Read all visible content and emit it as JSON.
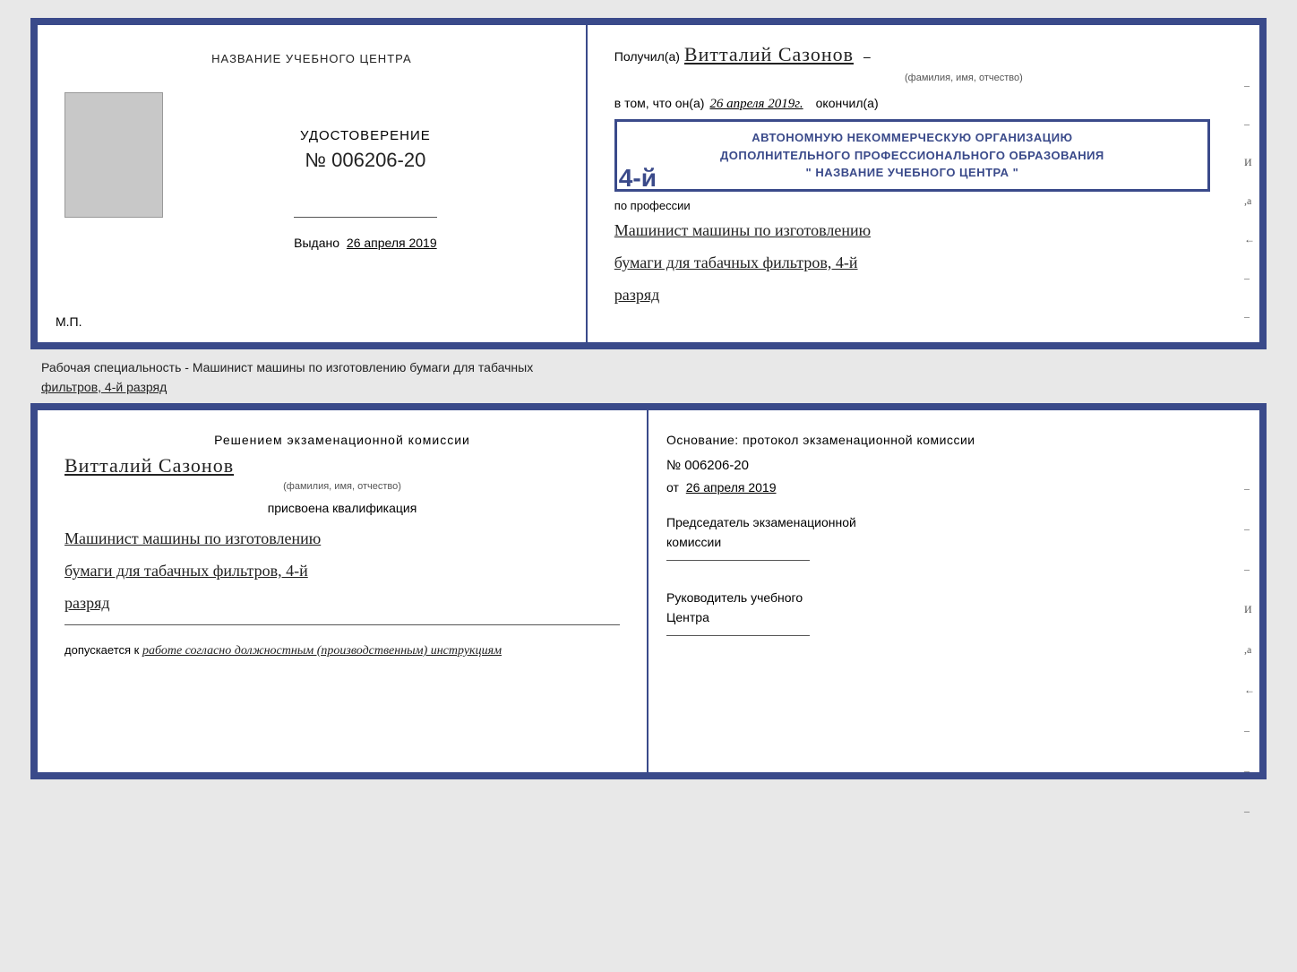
{
  "top_cert": {
    "left": {
      "title_label": "НАЗВАНИЕ УЧЕБНОГО ЦЕНТРА",
      "udostoverenie": "УДОСТОВЕРЕНИЕ",
      "number": "№ 006206-20",
      "vydano_label": "Выдано",
      "vydano_date": "26 апреля 2019",
      "mp": "М.П."
    },
    "right": {
      "poluchil_prefix": "Получил(а)",
      "recipient_name": "Витталий  Сазонов",
      "fio_hint": "(фамилия, имя, отчество)",
      "dash1": "–",
      "vtom_prefix": "в том, что он(а)",
      "date_handwritten": "26 апреля 2019г.",
      "okonchil": "окончил(а)",
      "stamp_line1": "АВТОНОМНУЮ НЕКОММЕРЧЕСКУЮ ОРГАНИЗАЦИЮ",
      "stamp_line2": "ДОПОЛНИТЕЛЬНОГО ПРОФЕССИОНАЛЬНОГО ОБРАЗОВАНИЯ",
      "stamp_line3": "\" НАЗВАНИЕ УЧЕБНОГО ЦЕНТРА \"",
      "number_big": "4-й",
      "po_professii": "по профессии",
      "profession1": "Машинист машины по изготовлению",
      "profession2": "бумаги для табачных фильтров, 4-й",
      "profession3": "разряд"
    }
  },
  "caption": {
    "text": "Рабочая специальность - Машинист машины по изготовлению бумаги для табачных",
    "text2": "фильтров, 4-й разряд"
  },
  "bottom_cert": {
    "left": {
      "resheniem": "Решением экзаменационной комиссии",
      "name": "Витталий Сазонов",
      "fio_hint": "(фамилия, имя, отчество)",
      "prisvoena": "присвоена квалификация",
      "qual1": "Машинист машины по изготовлению",
      "qual2": "бумаги для табачных фильтров, 4-й",
      "qual3": "разряд",
      "dopuskaetsya": "допускается к",
      "dopusk_text": "работе согласно должностным (производственным) инструкциям"
    },
    "right": {
      "osnovanie": "Основание: протокол экзаменационной комиссии",
      "number": "№  006206-20",
      "ot_label": "от",
      "ot_date": "26 апреля 2019",
      "predsedatel1": "Председатель экзаменационной",
      "predsedatel2": "комиссии",
      "rukovoditel1": "Руководитель учебного",
      "rukovoditel2": "Центра"
    }
  },
  "dashes": [
    "-",
    "-",
    "-",
    "И",
    ",а",
    "←",
    "-",
    "-"
  ]
}
